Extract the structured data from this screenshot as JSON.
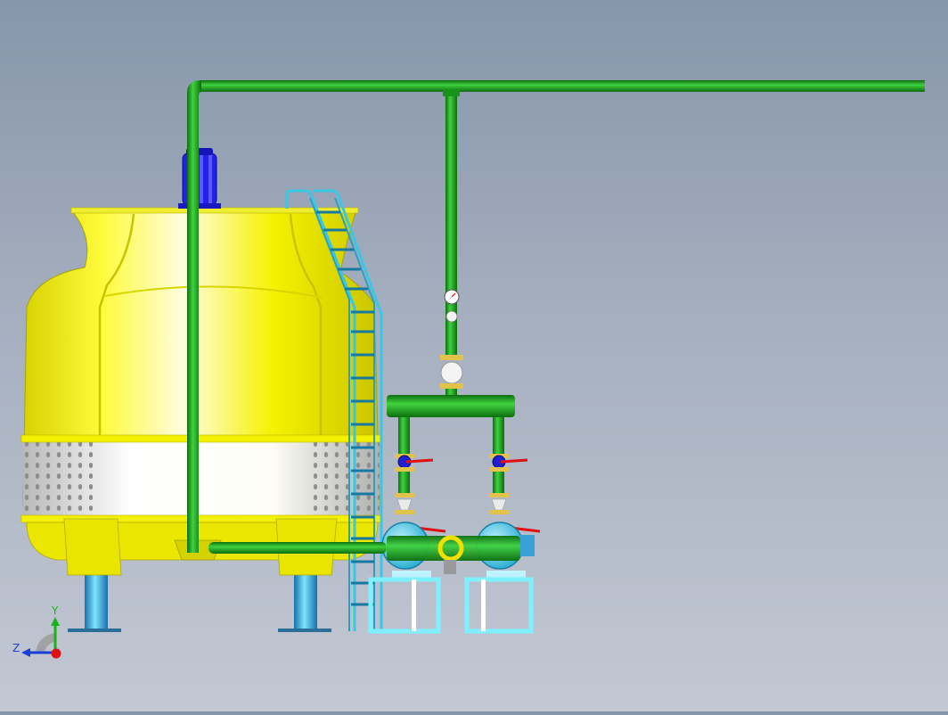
{
  "triad": {
    "y_label": "Y",
    "z_label": "Z"
  },
  "colors": {
    "tower_yellow": "#f3f000",
    "tower_shadow": "#c9c400",
    "pipe_green": "#1fa51f",
    "pipe_dark": "#0d6e0d",
    "ladder_cyan": "#38c8e6",
    "motor_blue": "#1e1ee0",
    "valve_red": "#e01010",
    "pump_cyan": "#48d4ee",
    "triad_y": "#19b319",
    "triad_z": "#1a3fd6",
    "triad_x": "#e01010"
  },
  "scene": {
    "objects": [
      "cooling-tower",
      "fan-motor",
      "access-ladder",
      "supply-pipe",
      "return-pipe",
      "pump-header",
      "pump-1",
      "pump-2",
      "pressure-gauge",
      "coordinate-triad"
    ]
  }
}
